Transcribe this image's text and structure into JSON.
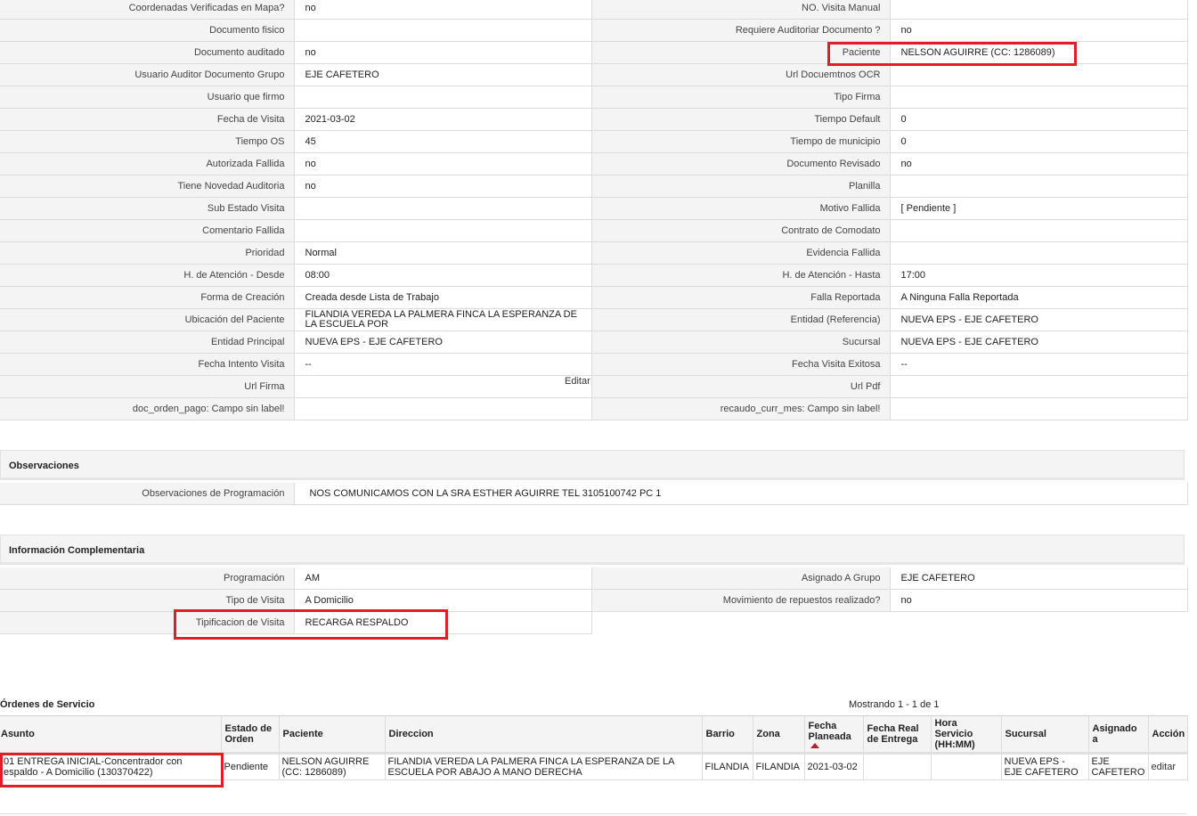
{
  "detail_rows": [
    {
      "l1": "Coordenadas Verificadas en Mapa?",
      "v1": "no",
      "l2": "NO. Visita Manual",
      "v2": ""
    },
    {
      "l1": "Documento fisico",
      "v1": "",
      "l2": "Requiere Auditoriar Documento ?",
      "v2": "no"
    },
    {
      "l1": "Documento auditado",
      "v1": "no",
      "l2": "Paciente",
      "v2": "NELSON AGUIRRE (CC: 1286089)"
    },
    {
      "l1": "Usuario Auditor Documento Grupo",
      "v1": "EJE CAFETERO",
      "l2": "Url Docuemtnos OCR",
      "v2": ""
    },
    {
      "l1": "Usuario que firmo",
      "v1": "",
      "l2": "Tipo Firma",
      "v2": ""
    },
    {
      "l1": "Fecha de Visita",
      "v1": "2021-03-02",
      "l2": "Tiempo Default",
      "v2": "0"
    },
    {
      "l1": "Tiempo OS",
      "v1": "45",
      "l2": "Tiempo de municipio",
      "v2": "0"
    },
    {
      "l1": "Autorizada Fallida",
      "v1": "no",
      "l2": "Documento Revisado",
      "v2": "no"
    },
    {
      "l1": "Tiene Novedad Auditoria",
      "v1": "no",
      "l2": "Planilla",
      "v2": ""
    },
    {
      "l1": "Sub Estado Visita",
      "v1": "",
      "l2": "Motivo Fallida",
      "v2": "[ Pendiente ]"
    },
    {
      "l1": "Comentario Fallida",
      "v1": "",
      "l2": "Contrato de Comodato",
      "v2": ""
    },
    {
      "l1": "Prioridad",
      "v1": "Normal",
      "l2": "Evidencia Fallida",
      "v2": ""
    },
    {
      "l1": "H. de Atención - Desde",
      "v1": "08:00",
      "l2": "H. de Atención - Hasta",
      "v2": "17:00"
    },
    {
      "l1": "Forma de Creación",
      "v1": "Creada desde Lista de Trabajo",
      "l2": "Falla Reportada",
      "v2": "A Ninguna Falla Reportada"
    },
    {
      "l1": "Ubicación del Paciente",
      "v1": "FILANDIA VEREDA LA PALMERA FINCA LA ESPERANZA DE LA ESCUELA POR",
      "l2": "Entidad (Referencia)",
      "v2": "NUEVA EPS - EJE CAFETERO"
    },
    {
      "l1": "Entidad Principal",
      "v1": "NUEVA EPS - EJE CAFETERO",
      "l2": "Sucursal",
      "v2": "NUEVA EPS - EJE CAFETERO"
    },
    {
      "l1": "Fecha Intento Visita",
      "v1": "--",
      "l2": "Fecha Visita Exitosa",
      "v2": "--"
    },
    {
      "l1": "Url Firma",
      "v1": "",
      "l2": "Url Pdf",
      "v2": ""
    },
    {
      "l1": "doc_orden_pago: Campo sin label!",
      "v1": "",
      "l2": "recaudo_curr_mes: Campo sin label!",
      "v2": ""
    }
  ],
  "editar_link": "Editar",
  "observaciones": {
    "title": "Observaciones",
    "label": "Observaciones de Programación",
    "value": "NOS COMUNICAMOS CON LA SRA ESTHER AGUIRRE TEL 3105100742 PC 1"
  },
  "info_comp": {
    "title": "Información Complementaria",
    "rows": [
      {
        "l1": "Programación",
        "v1": "AM",
        "l2": "Asignado A Grupo",
        "v2": "EJE CAFETERO"
      },
      {
        "l1": "Tipo de Visita",
        "v1": "A Domicilio",
        "l2": "Movimiento de repuestos realizado?",
        "v2": "no"
      }
    ],
    "tip_label": "Tipificacion de Visita",
    "tip_value": "RECARGA RESPALDO"
  },
  "orders": {
    "title": "Órdenes de Servicio",
    "showing": "Mostrando 1 - 1 de 1",
    "columns": [
      "Asunto",
      "Estado de Orden",
      "Paciente",
      "Direccion",
      "Barrio",
      "Zona",
      "Fecha Planeada",
      "Fecha Real de Entrega",
      "Hora Servicio (HH:MM)",
      "Sucursal",
      "Asignado a",
      "Acción"
    ],
    "rows": [
      {
        "asunto": "01 ENTREGA INICIAL-Concentrador con espaldo - A Domicilio (130370422)",
        "estado": "Pendiente",
        "paciente": "NELSON AGUIRRE (CC: 1286089)",
        "direccion": "FILANDIA VEREDA LA PALMERA FINCA LA ESPERANZA DE LA ESCUELA POR ABAJO A MANO DERECHA",
        "barrio": "FILANDIA",
        "zona": "FILANDIA",
        "fecha_planeada": "2021-03-02",
        "fecha_real": "",
        "hora": "",
        "sucursal": "NUEVA EPS - EJE CAFETERO",
        "asignado": "EJE CAFETERO",
        "accion": "editar"
      }
    ]
  },
  "colors": {
    "highlight": "#e11d2a",
    "sort_arrow": "#b3202a",
    "label_bg": "#f4f4f4"
  }
}
